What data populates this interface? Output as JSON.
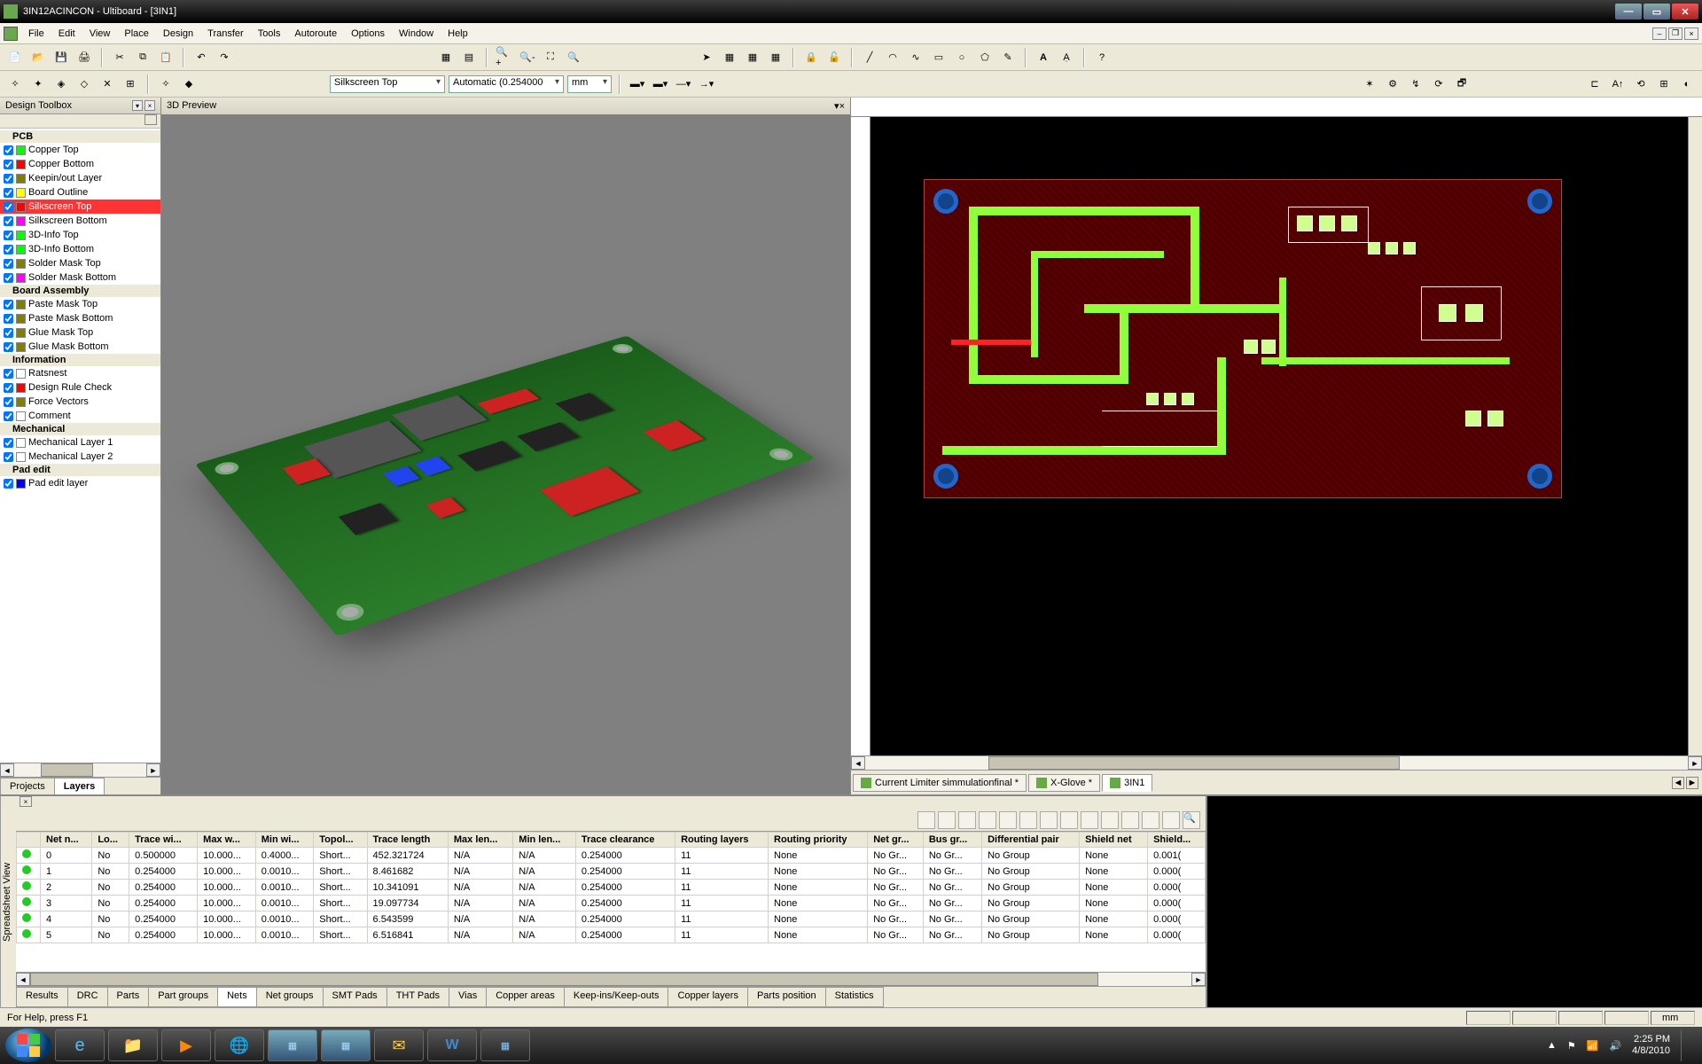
{
  "title": "3IN12ACINCON - Ultiboard - [3IN1]",
  "menu": [
    "File",
    "Edit",
    "View",
    "Place",
    "Design",
    "Transfer",
    "Tools",
    "Autoroute",
    "Options",
    "Window",
    "Help"
  ],
  "combos": {
    "layer": "Silkscreen Top",
    "grid": "Automatic (0.254000",
    "units": "mm"
  },
  "design_toolbox": {
    "title": "Design Toolbox",
    "sections": [
      {
        "header": "PCB",
        "items": [
          {
            "c": "#00ff00",
            "l": "Copper Top"
          },
          {
            "c": "#ff0000",
            "l": "Copper Bottom"
          },
          {
            "c": "#808000",
            "l": "Keepin/out Layer"
          },
          {
            "c": "#ffff00",
            "l": "Board Outline"
          },
          {
            "c": "#ff0000",
            "l": "Silkscreen Top",
            "sel": true
          },
          {
            "c": "#ff00ff",
            "l": "Silkscreen Bottom"
          },
          {
            "c": "#00ff00",
            "l": "3D-Info Top"
          },
          {
            "c": "#00ff00",
            "l": "3D-Info Bottom"
          },
          {
            "c": "#808000",
            "l": "Solder Mask Top"
          },
          {
            "c": "#ff00ff",
            "l": "Solder Mask Bottom"
          }
        ]
      },
      {
        "header": "Board Assembly",
        "items": [
          {
            "c": "#808000",
            "l": "Paste Mask Top"
          },
          {
            "c": "#808000",
            "l": "Paste Mask Bottom"
          },
          {
            "c": "#808000",
            "l": "Glue Mask Top"
          },
          {
            "c": "#808000",
            "l": "Glue Mask Bottom"
          }
        ]
      },
      {
        "header": "Information",
        "items": [
          {
            "c": "",
            "l": "Ratsnest"
          },
          {
            "c": "#ff0000",
            "l": "Design Rule Check"
          },
          {
            "c": "#808000",
            "l": "Force Vectors"
          },
          {
            "c": "",
            "l": "Comment"
          }
        ]
      },
      {
        "header": "Mechanical",
        "items": [
          {
            "c": "",
            "l": "Mechanical Layer 1"
          },
          {
            "c": "",
            "l": "Mechanical Layer 2"
          }
        ]
      },
      {
        "header": "Pad edit",
        "items": [
          {
            "c": "#0000ff",
            "l": "Pad edit layer"
          }
        ]
      }
    ],
    "tabs": [
      "Projects",
      "Layers"
    ],
    "active_tab": "Layers"
  },
  "preview_title": "3D Preview",
  "doc_tabs": [
    {
      "l": "Current Limiter simmulationfinal *"
    },
    {
      "l": "X-Glove *"
    },
    {
      "l": "3IN1",
      "active": true
    }
  ],
  "spreadsheet": {
    "side_label": "Spreadsheet View",
    "columns": [
      "",
      "Net n...",
      "Lo...",
      "Trace wi...",
      "Max w...",
      "Min wi...",
      "Topol...",
      "Trace length",
      "Max len...",
      "Min len...",
      "Trace clearance",
      "Routing layers",
      "Routing priority",
      "Net gr...",
      "Bus gr...",
      "Differential pair",
      "Shield net",
      "Shield..."
    ],
    "rows": [
      [
        "0",
        "No",
        "0.500000",
        "10.000...",
        "0.4000...",
        "Short...",
        "452.321724",
        "N/A",
        "N/A",
        "0.254000",
        "11",
        "None",
        "No Gr...",
        "No Gr...",
        "No Group",
        "None",
        "0.001("
      ],
      [
        "1",
        "No",
        "0.254000",
        "10.000...",
        "0.0010...",
        "Short...",
        "8.461682",
        "N/A",
        "N/A",
        "0.254000",
        "11",
        "None",
        "No Gr...",
        "No Gr...",
        "No Group",
        "None",
        "0.000("
      ],
      [
        "2",
        "No",
        "0.254000",
        "10.000...",
        "0.0010...",
        "Short...",
        "10.341091",
        "N/A",
        "N/A",
        "0.254000",
        "11",
        "None",
        "No Gr...",
        "No Gr...",
        "No Group",
        "None",
        "0.000("
      ],
      [
        "3",
        "No",
        "0.254000",
        "10.000...",
        "0.0010...",
        "Short...",
        "19.097734",
        "N/A",
        "N/A",
        "0.254000",
        "11",
        "None",
        "No Gr...",
        "No Gr...",
        "No Group",
        "None",
        "0.000("
      ],
      [
        "4",
        "No",
        "0.254000",
        "10.000...",
        "0.0010...",
        "Short...",
        "6.543599",
        "N/A",
        "N/A",
        "0.254000",
        "11",
        "None",
        "No Gr...",
        "No Gr...",
        "No Group",
        "None",
        "0.000("
      ],
      [
        "5",
        "No",
        "0.254000",
        "10.000...",
        "0.0010...",
        "Short...",
        "6.516841",
        "N/A",
        "N/A",
        "0.254000",
        "11",
        "None",
        "No Gr...",
        "No Gr...",
        "No Group",
        "None",
        "0.000("
      ]
    ],
    "tabs": [
      "Results",
      "DRC",
      "Parts",
      "Part groups",
      "Nets",
      "Net groups",
      "SMT Pads",
      "THT Pads",
      "Vias",
      "Copper areas",
      "Keep-ins/Keep-outs",
      "Copper layers",
      "Parts position",
      "Statistics"
    ],
    "active_tab": "Nets"
  },
  "status": {
    "help": "For Help, press F1",
    "unit": "mm"
  },
  "tray": {
    "time": "2:25 PM",
    "date": "4/8/2010"
  }
}
